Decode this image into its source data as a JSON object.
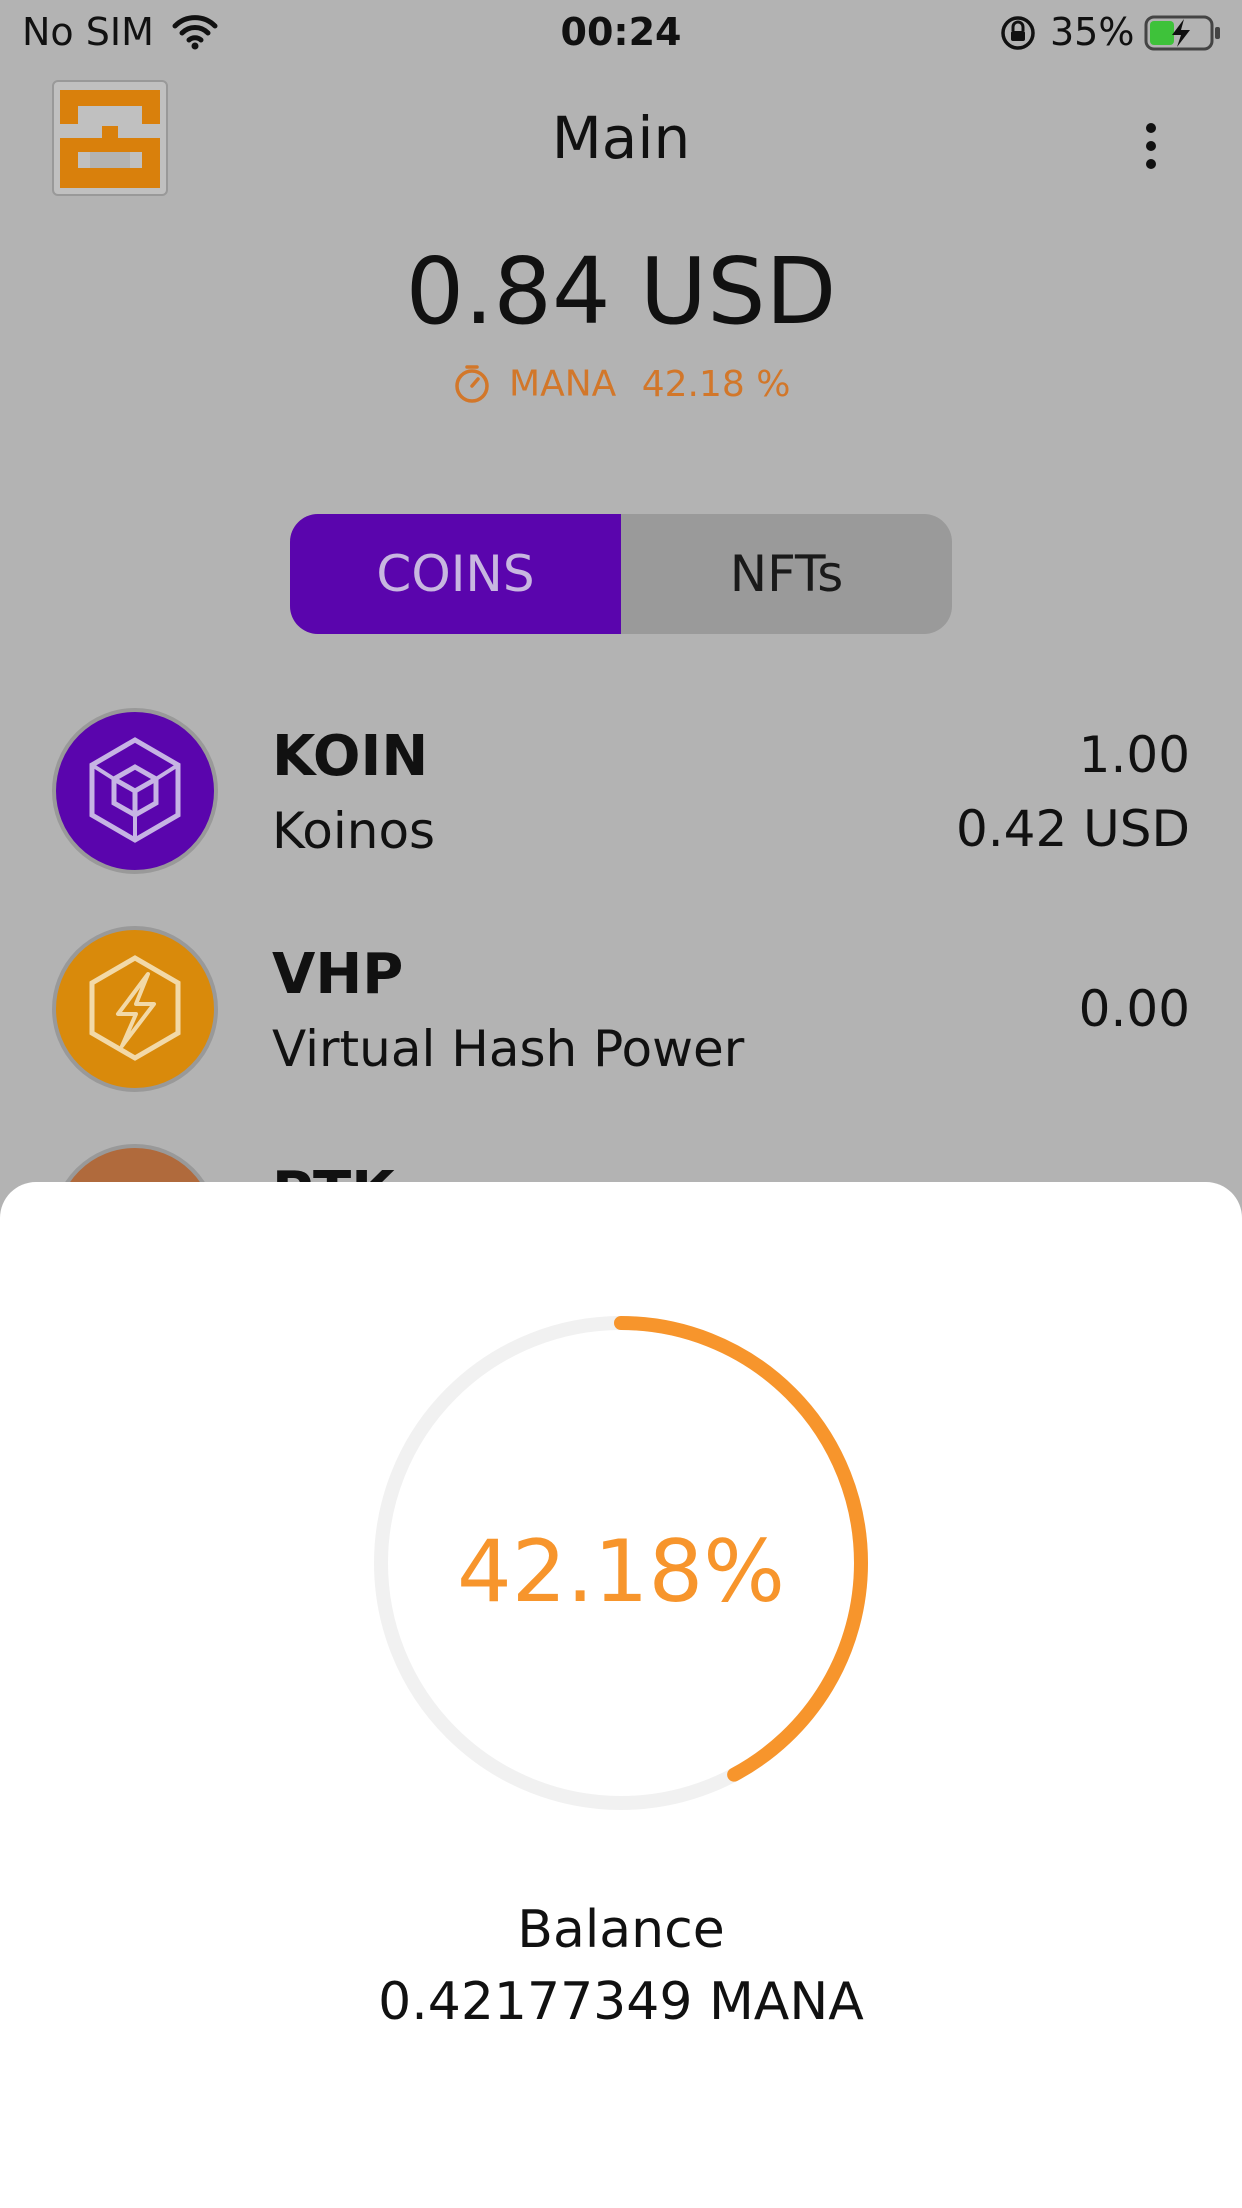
{
  "status_bar": {
    "carrier": "No SIM",
    "time": "00:24",
    "battery": "35%",
    "icons": [
      "wifi-icon",
      "orientation-lock-icon",
      "battery-charging-icon"
    ]
  },
  "header": {
    "title": "Main",
    "logo_icon": "app-logo",
    "menu_icon": "more-vertical-icon"
  },
  "summary": {
    "total": "0.84 USD",
    "mana_label": "MANA",
    "mana_percent": "42.18 %",
    "mana_icon": "timer-icon"
  },
  "tabs": [
    {
      "label": "COINS",
      "active": true
    },
    {
      "label": "NFTs",
      "active": false
    }
  ],
  "coins": [
    {
      "symbol": "KOIN",
      "name": "Koinos",
      "amount": "1.00",
      "value": "0.42 USD",
      "icon": "koin-cube-icon",
      "color": "#5a05ad"
    },
    {
      "symbol": "VHP",
      "name": "Virtual Hash Power",
      "amount": "0.00",
      "value": "",
      "icon": "vhp-lightning-icon",
      "color": "#d98a0b"
    },
    {
      "symbol": "PTK",
      "name": "",
      "amount": "",
      "value": "",
      "icon": "ptk-coin-icon",
      "color": "#b06a3c"
    }
  ],
  "mana_sheet": {
    "percent_text": "42.18%",
    "fraction": 0.4218,
    "balance_label": "Balance",
    "balance_value": "0.42177349 MANA",
    "accent": "#f7952c",
    "track": "#f1f1f1"
  },
  "colors": {
    "overlay_bg": "#b3b3b3",
    "tab_active": "#5a05ad",
    "mana_text": "#d2772a"
  }
}
